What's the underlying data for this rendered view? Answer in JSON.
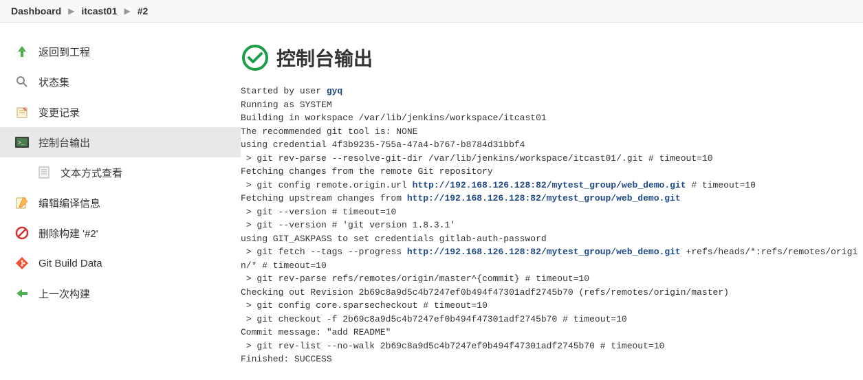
{
  "breadcrumb": {
    "dashboard": "Dashboard",
    "project": "itcast01",
    "build": "#2"
  },
  "sidebar": {
    "back": "返回到工程",
    "status": "状态集",
    "changes": "变更记录",
    "console": "控制台输出",
    "textview": "文本方式查看",
    "editinfo": "编辑编译信息",
    "delete": "删除构建 '#2'",
    "gitdata": "Git Build Data",
    "prevbuild": "上一次构建"
  },
  "page": {
    "title": "控制台输出"
  },
  "console": {
    "started_by": "Started by user ",
    "user": "gyq",
    "lines_a": "Running as SYSTEM\nBuilding in workspace /var/lib/jenkins/workspace/itcast01\nThe recommended git tool is: NONE\nusing credential 4f3b9235-755a-47a4-b767-b8784d31bbf4\n > git rev-parse --resolve-git-dir /var/lib/jenkins/workspace/itcast01/.git # timeout=10\nFetching changes from the remote Git repository\n > git config remote.origin.url ",
    "url1": "http://192.168.126.128:82/mytest_group/web_demo.git",
    "after_url1": " # timeout=10\nFetching upstream changes from ",
    "url2": "http://192.168.126.128:82/mytest_group/web_demo.git",
    "lines_b": "\n > git --version # timeout=10\n > git --version # 'git version 1.8.3.1'\nusing GIT_ASKPASS to set credentials gitlab-auth-password\n > git fetch --tags --progress ",
    "url3": "http://192.168.126.128:82/mytest_group/web_demo.git",
    "lines_c": " +refs/heads/*:refs/remotes/origin/* # timeout=10\n > git rev-parse refs/remotes/origin/master^{commit} # timeout=10\nChecking out Revision 2b69c8a9d5c4b7247ef0b494f47301adf2745b70 (refs/remotes/origin/master)\n > git config core.sparsecheckout # timeout=10\n > git checkout -f 2b69c8a9d5c4b7247ef0b494f47301adf2745b70 # timeout=10\nCommit message: \"add README\"\n > git rev-list --no-walk 2b69c8a9d5c4b7247ef0b494f47301adf2745b70 # timeout=10\nFinished: SUCCESS"
  }
}
